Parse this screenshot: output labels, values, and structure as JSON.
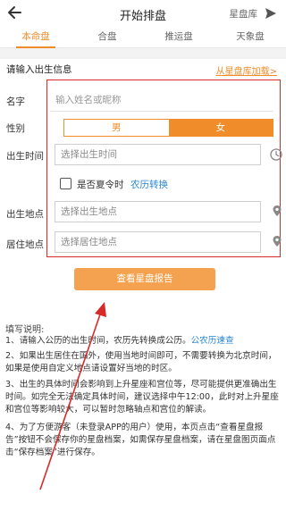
{
  "header": {
    "title": "开始排盘",
    "right_label": "星盘库"
  },
  "tabs": [
    {
      "label": "本命盘",
      "active": true
    },
    {
      "label": "合盘",
      "active": false
    },
    {
      "label": "推运盘",
      "active": false
    },
    {
      "label": "天象盘",
      "active": false
    }
  ],
  "form": {
    "section_title": "请输入出生信息",
    "library_link": "从星盘库加载>",
    "name_label": "名字",
    "name_placeholder": "输入姓名或昵称",
    "gender_label": "性别",
    "gender_male": "男",
    "gender_female": "女",
    "gender_selected": "女",
    "birth_time_label": "出生时间",
    "birth_time_placeholder": "选择出生时间",
    "dst_label": "是否夏令时",
    "dst_checked": false,
    "lunar_link": "农历转换",
    "birth_place_label": "出生地点",
    "birth_place_placeholder": "选择出生地点",
    "residence_label": "居住地点",
    "residence_placeholder": "选择居住地点",
    "submit_label": "查看星盘报告"
  },
  "notes": {
    "title": "填写说明:",
    "item1": "1、请输入公历的出生时间，农历先转换成公历。",
    "item1_link": "公农历速查",
    "item2": "2、如果出生居住在国外，使用当地时间即可，不需要转换为北京时间，如果是使用自定义地点请设置好当地的时区。",
    "item3": "3、出生的具体时间会影响到上升星座和宫位等，尽可能提供更准确出生时间。如完全无法确定具体时间，建议选择中午12:00，此时对上升星座和宫位等影响较大，可以暂时忽略轴点和宫位的解读。",
    "item4": "4、为了方便游客（未登录APP的用户）使用，本页点击“查看星盘报告”按钮不会保存你的星盘档案，如需保存星盘档案，请在星盘图页面点击“保存档案”进行保存。"
  },
  "colors": {
    "accent": "#f08c2a",
    "submit": "#f4a24f",
    "link": "#2a87d8",
    "annotation_red": "#d72a2a"
  }
}
